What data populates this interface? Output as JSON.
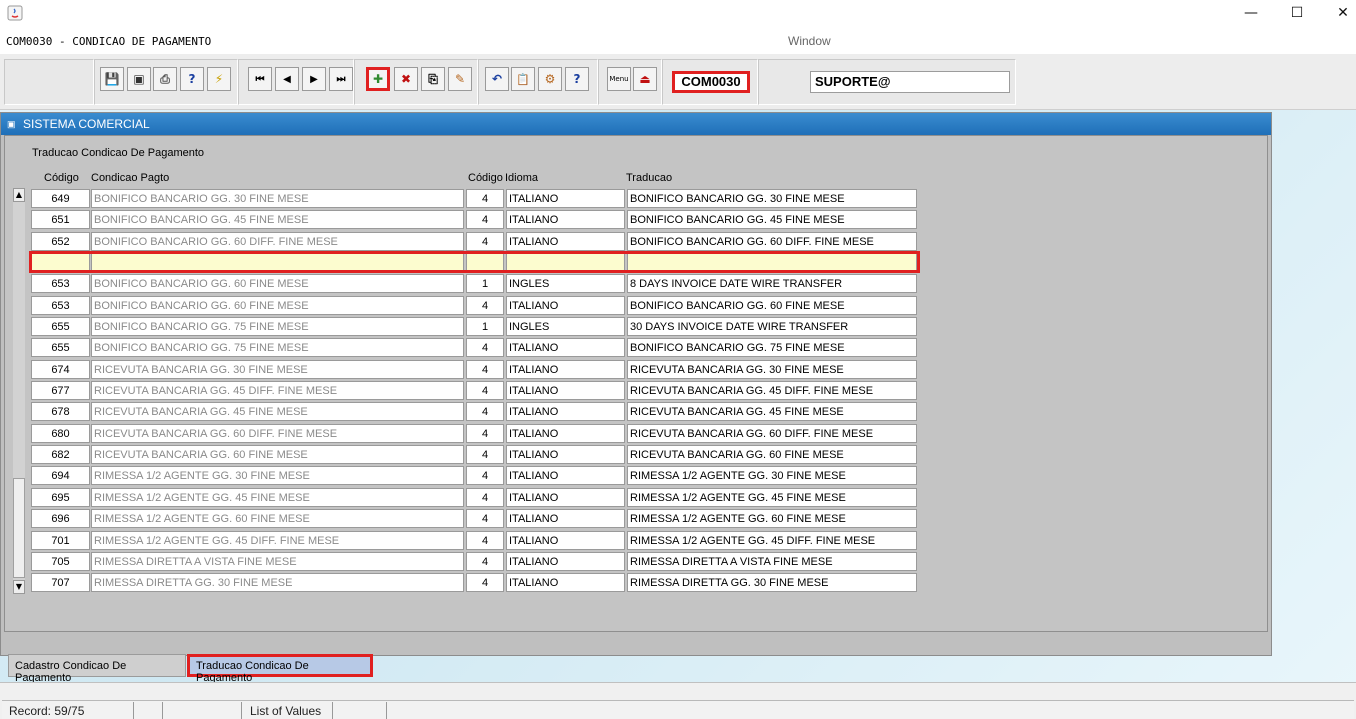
{
  "window": {
    "form_title": "COM0030 - CONDICAO DE PAGAMENTO",
    "window_label": "Window",
    "controls": {
      "minimize": "—",
      "maximize": "☐",
      "close": "✕"
    }
  },
  "toolbar": {
    "form_code": "COM0030",
    "user": "SUPORTE@",
    "buttons": [
      {
        "name": "save-icon",
        "glyph": "💾"
      },
      {
        "name": "print-preview-icon",
        "glyph": "▣"
      },
      {
        "name": "print-icon",
        "glyph": "⎙"
      },
      {
        "name": "query-icon",
        "glyph": "?"
      },
      {
        "name": "execute-query-icon",
        "glyph": "⚡"
      },
      {
        "name": "first-record-icon",
        "glyph": "⏮"
      },
      {
        "name": "previous-record-icon",
        "glyph": "◀"
      },
      {
        "name": "next-record-icon",
        "glyph": "▶"
      },
      {
        "name": "last-record-icon",
        "glyph": "⏭"
      },
      {
        "name": "insert-record-icon",
        "glyph": "✚"
      },
      {
        "name": "delete-record-icon",
        "glyph": "✖"
      },
      {
        "name": "duplicate-record-icon",
        "glyph": "⎘"
      },
      {
        "name": "edit-icon",
        "glyph": "✎"
      },
      {
        "name": "undo-icon",
        "glyph": "↶"
      },
      {
        "name": "clipboard-icon",
        "glyph": "📋"
      },
      {
        "name": "settings-icon",
        "glyph": "⚙"
      },
      {
        "name": "help-icon",
        "glyph": "?"
      },
      {
        "name": "menu-icon",
        "glyph": "Menu"
      },
      {
        "name": "exit-icon",
        "glyph": "⏏"
      }
    ]
  },
  "main": {
    "window_title": "SISTEMA COMERCIAL",
    "block_title": "Traducao Condicao De Pagamento",
    "columns": {
      "codigo": "Código",
      "condicao": "Condicao Pagto",
      "codigo2": "Código",
      "idioma": "Idioma",
      "traducao": "Traducao"
    },
    "rows": [
      {
        "codigo": "649",
        "condicao": "BONIFICO BANCARIO GG. 30 FINE MESE",
        "codigo2": "4",
        "idioma": "ITALIANO",
        "traducao": "BONIFICO BANCARIO GG. 30 FINE MESE"
      },
      {
        "codigo": "651",
        "condicao": "BONIFICO BANCARIO GG. 45 FINE MESE",
        "codigo2": "4",
        "idioma": "ITALIANO",
        "traducao": "BONIFICO BANCARIO GG. 45 FINE MESE"
      },
      {
        "codigo": "652",
        "condicao": "BONIFICO BANCARIO GG. 60 DIFF. FINE MESE",
        "codigo2": "4",
        "idioma": "ITALIANO",
        "traducao": "BONIFICO BANCARIO GG. 60 DIFF. FINE MESE"
      },
      {
        "codigo": "",
        "condicao": "",
        "codigo2": "",
        "idioma": "",
        "traducao": "",
        "new": true
      },
      {
        "codigo": "653",
        "condicao": "BONIFICO BANCARIO GG. 60 FINE MESE",
        "codigo2": "1",
        "idioma": "INGLES",
        "traducao": "8 DAYS INVOICE DATE WIRE TRANSFER"
      },
      {
        "codigo": "653",
        "condicao": "BONIFICO BANCARIO GG. 60 FINE MESE",
        "codigo2": "4",
        "idioma": "ITALIANO",
        "traducao": "BONIFICO BANCARIO GG. 60 FINE MESE"
      },
      {
        "codigo": "655",
        "condicao": "BONIFICO BANCARIO GG. 75 FINE MESE",
        "codigo2": "1",
        "idioma": "INGLES",
        "traducao": "30 DAYS INVOICE DATE WIRE TRANSFER"
      },
      {
        "codigo": "655",
        "condicao": "BONIFICO BANCARIO GG. 75 FINE MESE",
        "codigo2": "4",
        "idioma": "ITALIANO",
        "traducao": "BONIFICO BANCARIO GG. 75 FINE MESE"
      },
      {
        "codigo": "674",
        "condicao": "RICEVUTA BANCARIA GG. 30 FINE MESE",
        "codigo2": "4",
        "idioma": "ITALIANO",
        "traducao": "RICEVUTA BANCARIA GG. 30 FINE MESE"
      },
      {
        "codigo": "677",
        "condicao": "RICEVUTA BANCARIA GG. 45 DIFF. FINE MESE",
        "codigo2": "4",
        "idioma": "ITALIANO",
        "traducao": "RICEVUTA BANCARIA GG. 45 DIFF. FINE MESE"
      },
      {
        "codigo": "678",
        "condicao": "RICEVUTA BANCARIA GG. 45 FINE MESE",
        "codigo2": "4",
        "idioma": "ITALIANO",
        "traducao": "RICEVUTA BANCARIA GG. 45 FINE MESE"
      },
      {
        "codigo": "680",
        "condicao": "RICEVUTA BANCARIA GG. 60 DIFF. FINE MESE",
        "codigo2": "4",
        "idioma": "ITALIANO",
        "traducao": "RICEVUTA BANCARIA GG. 60 DIFF. FINE MESE"
      },
      {
        "codigo": "682",
        "condicao": "RICEVUTA BANCARIA GG. 60 FINE MESE",
        "codigo2": "4",
        "idioma": "ITALIANO",
        "traducao": "RICEVUTA BANCARIA GG. 60 FINE MESE"
      },
      {
        "codigo": "694",
        "condicao": "RIMESSA 1/2 AGENTE GG. 30 FINE MESE",
        "codigo2": "4",
        "idioma": "ITALIANO",
        "traducao": "RIMESSA 1/2 AGENTE GG. 30 FINE MESE"
      },
      {
        "codigo": "695",
        "condicao": "RIMESSA 1/2 AGENTE GG. 45 FINE MESE",
        "codigo2": "4",
        "idioma": "ITALIANO",
        "traducao": "RIMESSA 1/2 AGENTE GG. 45 FINE MESE"
      },
      {
        "codigo": "696",
        "condicao": "RIMESSA 1/2 AGENTE GG. 60 FINE MESE",
        "codigo2": "4",
        "idioma": "ITALIANO",
        "traducao": "RIMESSA 1/2 AGENTE GG. 60 FINE MESE"
      },
      {
        "codigo": "701",
        "condicao": "RIMESSA 1/2 AGENTE GG. 45 DIFF. FINE MESE",
        "codigo2": "4",
        "idioma": "ITALIANO",
        "traducao": "RIMESSA 1/2 AGENTE GG. 45 DIFF. FINE MESE"
      },
      {
        "codigo": "705",
        "condicao": "RIMESSA DIRETTA A VISTA FINE MESE",
        "codigo2": "4",
        "idioma": "ITALIANO",
        "traducao": "RIMESSA DIRETTA A VISTA FINE MESE"
      },
      {
        "codigo": "707",
        "condicao": "RIMESSA DIRETTA GG. 30 FINE MESE",
        "codigo2": "4",
        "idioma": "ITALIANO",
        "traducao": "RIMESSA DIRETTA GG. 30 FINE MESE"
      }
    ],
    "tabs": [
      {
        "label": "Cadastro Condicao De Pagamento",
        "active": false
      },
      {
        "label": "Traducao Condicao De Pagamento",
        "active": true
      }
    ]
  },
  "status": {
    "record": "Record: 59/75",
    "list_of_values": "List of Values"
  }
}
